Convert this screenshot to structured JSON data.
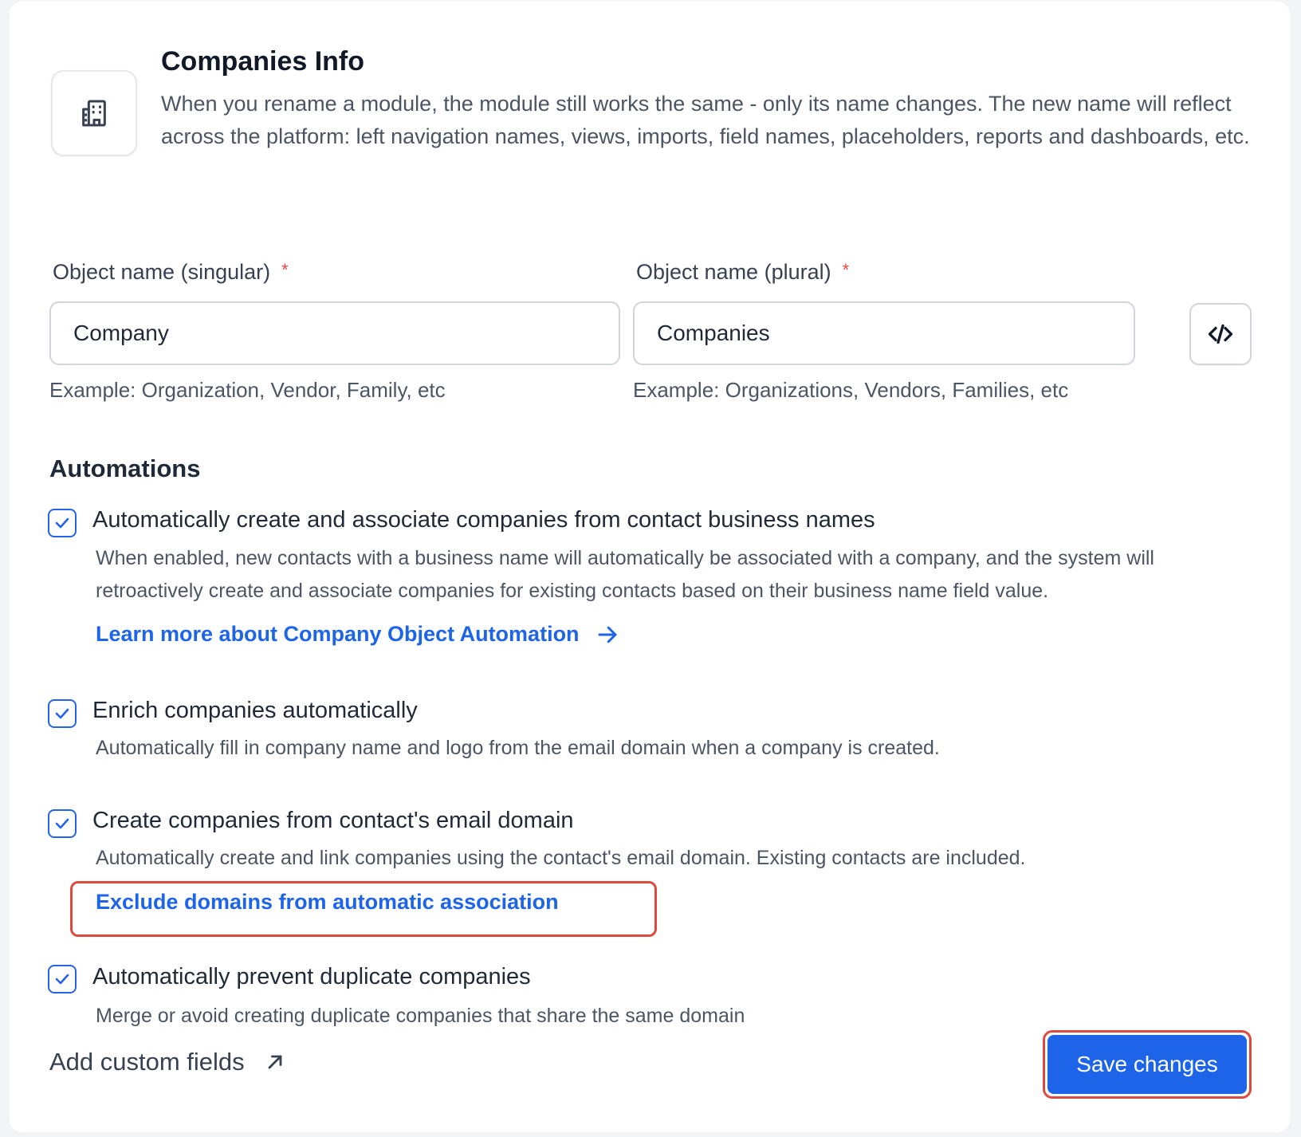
{
  "header": {
    "title": "Companies Info",
    "description": "When you rename a module, the module still works the same - only its name changes. The new name will reflect across the platform: left navigation names, views, imports, field names, placeholders, reports and dashboards, etc.",
    "icon": "building-icon"
  },
  "fields": {
    "singular": {
      "label": "Object name (singular)",
      "required_mark": "*",
      "value": "Company",
      "hint": "Example: Organization, Vendor, Family, etc"
    },
    "plural": {
      "label": "Object name (plural)",
      "required_mark": "*",
      "value": "Companies",
      "hint": "Example: Organizations, Vendors, Families, etc"
    },
    "code_button_icon": "code-icon"
  },
  "automations": {
    "title": "Automations",
    "options": [
      {
        "checked": true,
        "title": "Automatically create and associate companies from contact business names",
        "description": "When enabled, new contacts with a business name will automatically be associated with a company, and the system will retroactively create and associate companies for existing contacts based on their business name field value.",
        "link": "Learn more about Company Object Automation"
      },
      {
        "checked": true,
        "title": "Enrich companies automatically",
        "description": "Automatically fill in company name and logo from the email domain when a company is created."
      },
      {
        "checked": true,
        "title": "Create companies from contact's email domain",
        "description": "Automatically create and link companies using the contact's email domain. Existing contacts are included.",
        "link": "Exclude domains from automatic association"
      },
      {
        "checked": true,
        "title": "Automatically prevent duplicate companies",
        "description": "Merge or avoid creating duplicate companies that share the same domain"
      }
    ]
  },
  "footer": {
    "custom_fields_label": "Add custom fields",
    "save_label": "Save changes"
  },
  "colors": {
    "primary": "#1d64e8",
    "highlight": "#dc4a3d",
    "required": "#ef4444"
  }
}
